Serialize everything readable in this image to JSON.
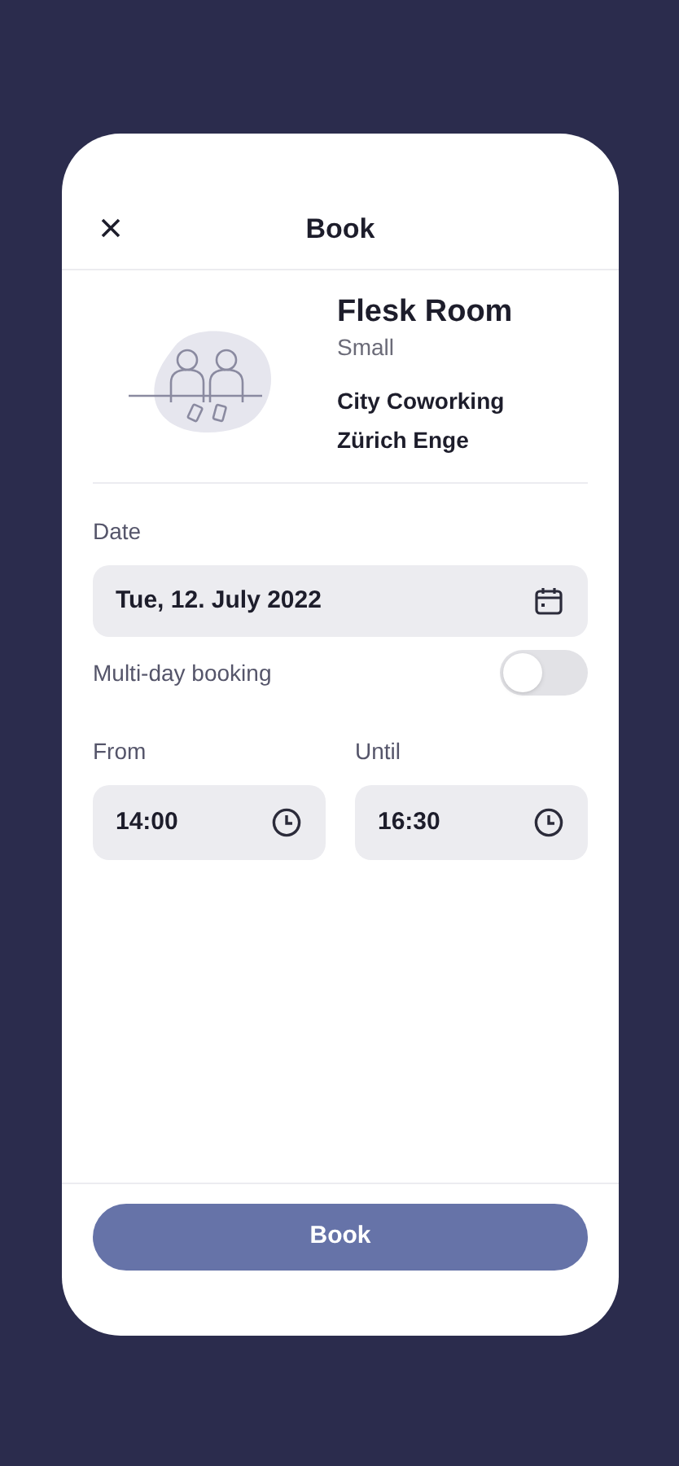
{
  "header": {
    "title": "Book"
  },
  "room": {
    "name": "Flesk Room",
    "size": "Small",
    "location_lines": [
      "City Coworking",
      "Zürich Enge"
    ]
  },
  "date": {
    "label": "Date",
    "value": "Tue, 12. July 2022"
  },
  "multi_day": {
    "label": "Multi-day booking",
    "on": false
  },
  "times": [
    {
      "label": "From",
      "value": "14:00"
    },
    {
      "label": "Until",
      "value": "16:30"
    }
  ],
  "button": {
    "label": "Book"
  }
}
